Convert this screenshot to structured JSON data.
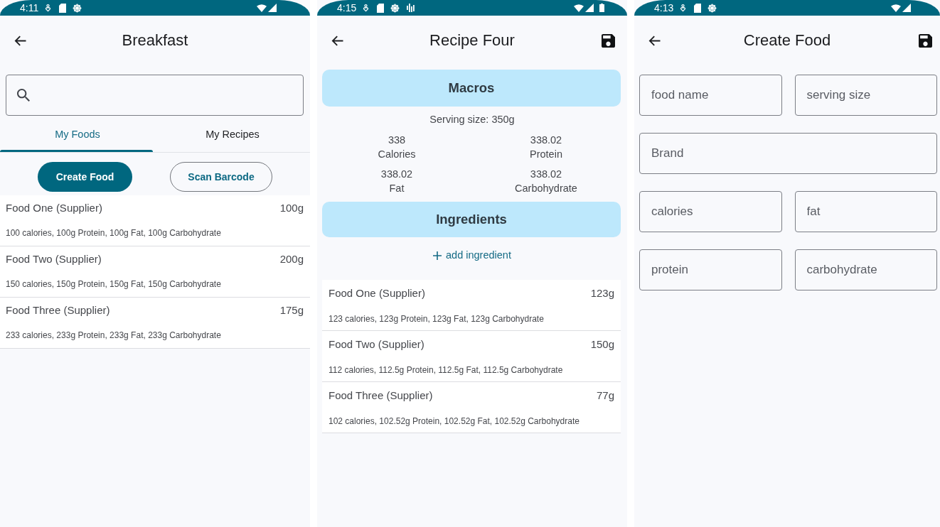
{
  "screens": [
    {
      "kind": "food_list",
      "status_bar": {
        "time": "4:11",
        "extra_notification": false,
        "battery": false
      },
      "app_bar": {
        "title": "Breakfast",
        "save_action": false
      },
      "tabs": [
        {
          "label": "My Foods",
          "selected": true
        },
        {
          "label": "My Recipes",
          "selected": false
        }
      ],
      "buttons": [
        {
          "label": "Create Food",
          "kind": "filled"
        },
        {
          "label": "Scan Barcode",
          "kind": "outlined"
        }
      ],
      "foods": [
        {
          "name": "Food One (Supplier)",
          "amount": "100g",
          "macros": "100 calories, 100g Protein, 100g Fat, 100g Carbohydrate"
        },
        {
          "name": "Food Two (Supplier)",
          "amount": "200g",
          "macros": "150 calories, 150g Protein, 150g Fat, 150g Carbohydrate"
        },
        {
          "name": "Food Three (Supplier)",
          "amount": "175g",
          "macros": "233 calories, 233g Protein, 233g Fat, 233g Carbohydrate"
        }
      ]
    },
    {
      "kind": "recipe",
      "status_bar": {
        "time": "4:15",
        "extra_notification": true,
        "battery": true
      },
      "app_bar": {
        "title": "Recipe Four",
        "save_action": true
      },
      "macros": {
        "heading": "Macros",
        "serving_size": "Serving size: 350g",
        "values": [
          {
            "value": "338",
            "label": "Calories"
          },
          {
            "value": "338.02",
            "label": "Protein"
          },
          {
            "value": "338.02",
            "label": "Fat"
          },
          {
            "value": "338.02",
            "label": "Carbohydrate"
          }
        ]
      },
      "ingredients": {
        "heading": "Ingredients",
        "add_label": "add ingredient",
        "items": [
          {
            "name": "Food One (Supplier)",
            "amount": "123g",
            "macros": "123 calories, 123g Protein, 123g Fat, 123g Carbohydrate"
          },
          {
            "name": "Food Two (Supplier)",
            "amount": "150g",
            "macros": "112 calories, 112.5g Protein, 112.5g Fat, 112.5g Carbohydrate"
          },
          {
            "name": "Food Three (Supplier)",
            "amount": "77g",
            "macros": "102 calories, 102.52g Protein, 102.52g Fat, 102.52g Carbohydrate"
          }
        ]
      }
    },
    {
      "kind": "create_food",
      "status_bar": {
        "time": "4:13",
        "extra_notification": false,
        "battery": false
      },
      "app_bar": {
        "title": "Create Food",
        "save_action": true
      },
      "field_rows": [
        {
          "fields": [
            {
              "placeholder": "food name"
            },
            {
              "placeholder": "serving size"
            }
          ]
        },
        {
          "fields": [
            {
              "placeholder": "Brand"
            }
          ]
        },
        {
          "fields": [
            {
              "placeholder": "calories"
            },
            {
              "placeholder": "fat"
            }
          ]
        },
        {
          "fields": [
            {
              "placeholder": "protein"
            },
            {
              "placeholder": "carbohydrate"
            }
          ]
        }
      ]
    }
  ]
}
